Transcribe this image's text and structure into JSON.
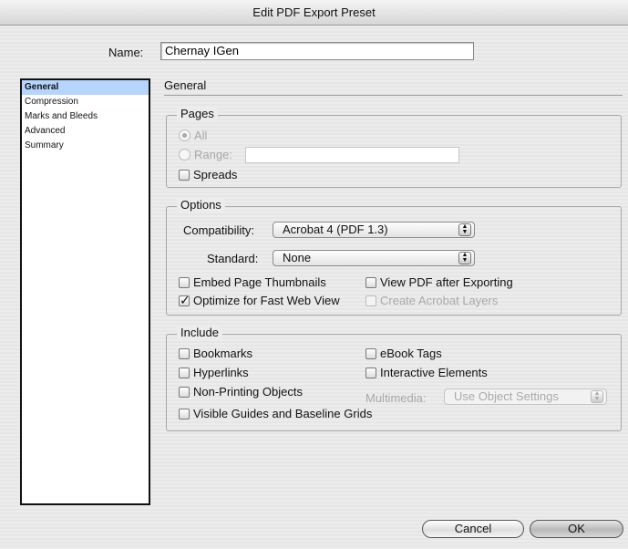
{
  "window": {
    "title": "Edit PDF Export Preset"
  },
  "name": {
    "label": "Name:",
    "value": "Chernay IGen"
  },
  "sidebar": {
    "items": [
      {
        "label": "General",
        "selected": true
      },
      {
        "label": "Compression",
        "selected": false
      },
      {
        "label": "Marks and Bleeds",
        "selected": false
      },
      {
        "label": "Advanced",
        "selected": false
      },
      {
        "label": "Summary",
        "selected": false
      }
    ]
  },
  "section": {
    "title": "General"
  },
  "pages": {
    "title": "Pages",
    "all_label": "All",
    "range_label": "Range:",
    "range_value": "",
    "spreads_label": "Spreads"
  },
  "options": {
    "title": "Options",
    "compatibility_label": "Compatibility:",
    "compatibility_value": "Acrobat 4 (PDF 1.3)",
    "standard_label": "Standard:",
    "standard_value": "None",
    "embed_thumbnails_label": "Embed Page Thumbnails",
    "optimize_label": "Optimize for Fast Web View",
    "view_pdf_label": "View PDF after Exporting",
    "acrobat_layers_label": "Create Acrobat Layers"
  },
  "include": {
    "title": "Include",
    "bookmarks_label": "Bookmarks",
    "hyperlinks_label": "Hyperlinks",
    "non_printing_label": "Non-Printing Objects",
    "guides_label": "Visible Guides and Baseline Grids",
    "ebook_tags_label": "eBook Tags",
    "interactive_label": "Interactive Elements",
    "multimedia_label": "Multimedia:",
    "multimedia_value": "Use Object Settings"
  },
  "buttons": {
    "cancel": "Cancel",
    "ok": "OK"
  }
}
